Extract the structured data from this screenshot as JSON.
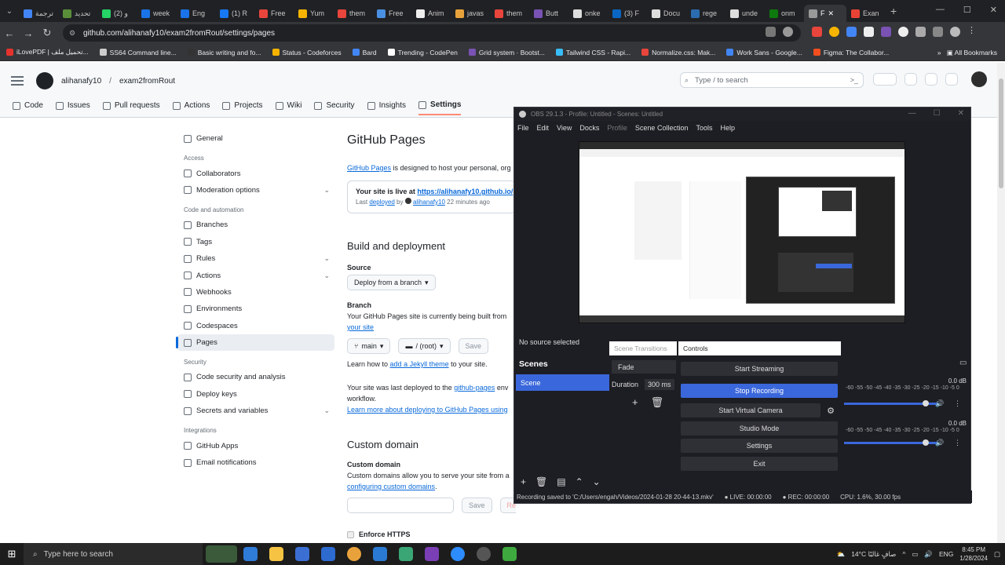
{
  "tabs": [
    {
      "label": "ترجمة",
      "color": "#4285f4"
    },
    {
      "label": "تحديد",
      "color": "#5a8f3a"
    },
    {
      "label": "(2) و",
      "color": "#25d366"
    },
    {
      "label": "week",
      "color": "#1a73e8"
    },
    {
      "label": "Eng",
      "color": "#1a73e8"
    },
    {
      "label": "(1) R",
      "color": "#1877f2"
    },
    {
      "label": "Free",
      "color": "#e8453c"
    },
    {
      "label": "Yum",
      "color": "#f6b400"
    },
    {
      "label": "them",
      "color": "#e8453c"
    },
    {
      "label": "Free",
      "color": "#4a90e2"
    },
    {
      "label": "Anim",
      "color": "#eee"
    },
    {
      "label": "javas",
      "color": "#e9a23b"
    },
    {
      "label": "them",
      "color": "#e8453c"
    },
    {
      "label": "Butt",
      "color": "#7952b3"
    },
    {
      "label": "onke",
      "color": "#ddd"
    },
    {
      "label": "(3) F",
      "color": "#0a66c2"
    },
    {
      "label": "Docu",
      "color": "#ddd"
    },
    {
      "label": "rege",
      "color": "#2b6cb0"
    },
    {
      "label": "unde",
      "color": "#ddd"
    },
    {
      "label": "onm",
      "color": "#0e7a0d"
    },
    {
      "label": "F",
      "color": "#999"
    },
    {
      "label": "Exan",
      "color": "#ea4335"
    }
  ],
  "address": {
    "url": "github.com/alihanafy10/exam2fromRout/settings/pages"
  },
  "bookmarks": [
    {
      "label": "iLovePDF | تحميل ملف...",
      "color": "#e5322d"
    },
    {
      "label": "SS64 Command line...",
      "color": "#ccc"
    },
    {
      "label": "Basic writing and fo...",
      "color": "#333"
    },
    {
      "label": "Status - Codeforces",
      "color": "#f6b400"
    },
    {
      "label": "Bard",
      "color": "#4285f4"
    },
    {
      "label": "Trending - CodePen",
      "color": "#fff"
    },
    {
      "label": "Grid system · Bootst...",
      "color": "#7952b3"
    },
    {
      "label": "Tailwind CSS - Rapi...",
      "color": "#38bdf8"
    },
    {
      "label": "Normalize.css: Mak...",
      "color": "#e8453c"
    },
    {
      "label": "Work Sans - Google...",
      "color": "#4285f4"
    },
    {
      "label": "Figma: The Collabor...",
      "color": "#f24e1e"
    }
  ],
  "bookmarks_all": "All Bookmarks",
  "gh": {
    "owner": "alihanafy10",
    "repo": "exam2fromRout",
    "search_placeholder": "Type / to search",
    "repo_tabs": [
      "Code",
      "Issues",
      "Pull requests",
      "Actions",
      "Projects",
      "Wiki",
      "Security",
      "Insights",
      "Settings"
    ]
  },
  "sidebar": {
    "general": "General",
    "access_h": "Access",
    "access": [
      "Collaborators",
      "Moderation options"
    ],
    "code_h": "Code and automation",
    "code": [
      "Branches",
      "Tags",
      "Rules",
      "Actions",
      "Webhooks",
      "Environments",
      "Codespaces",
      "Pages"
    ],
    "security_h": "Security",
    "security": [
      "Code security and analysis",
      "Deploy keys",
      "Secrets and variables"
    ],
    "integrations_h": "Integrations",
    "integrations": [
      "GitHub Apps",
      "Email notifications"
    ]
  },
  "main": {
    "title": "GitHub Pages",
    "intro_link": "GitHub Pages",
    "intro": " is designed to host your personal, org",
    "live_prefix": "Your site is live at ",
    "live_url": "https://alihanafy10.github.io/",
    "last": "Last ",
    "deployed": "deployed",
    "by": " by ",
    "user": "alihanafy10",
    "ago": " 22 minutes ago",
    "build_title": "Build and deployment",
    "source_label": "Source",
    "source_value": "Deploy from a branch",
    "branch_label": "Branch",
    "branch_desc": "Your GitHub Pages site is currently being built from",
    "your_site": "your site",
    "branch_value": "main",
    "folder_value": "/ (root)",
    "save": "Save",
    "learn_prefix": "Learn how to ",
    "jekyll": "add a Jekyll theme",
    "learn_suffix": " to your site.",
    "deployed_prefix": "Your site was last deployed to the ",
    "gh_pages": "github-pages",
    "deployed_suffix": " env",
    "workflow": "workflow.",
    "learn_more": "Learn more about deploying to GitHub Pages using",
    "custom_title": "Custom domain",
    "custom_label": "Custom domain",
    "custom_desc": "Custom domains allow you to serve your site from a",
    "configuring": "configuring custom domains",
    "save2": "Save",
    "remove": "Remove",
    "https": "Enforce HTTPS"
  },
  "obs": {
    "title": "OBS 29.1.3 - Profile: Untitled - Scenes: Untitled",
    "menu": [
      "File",
      "Edit",
      "View",
      "Docks",
      "Profile",
      "Scene Collection",
      "Tools",
      "Help"
    ],
    "no_source": "No source selected",
    "scene_transitions": "Scene Transitions",
    "controls": "Controls",
    "scenes": "Scenes",
    "scene_item": "Scene",
    "transition": "Fade",
    "duration_label": "Duration",
    "duration_value": "300 ms",
    "buttons": [
      "Start Streaming",
      "Stop Recording",
      "Start Virtual Camera",
      "Studio Mode",
      "Settings",
      "Exit"
    ],
    "db1": "0.0 dB",
    "db2": "0.0 dB",
    "scale": "-60  -55  -50  -45  -40  -35  -30  -25  -20  -15  -10  -5  0",
    "status_saved": "Recording saved to 'C:/Users/engah/Videos/2024-01-28 20-44-13.mkv'",
    "live": "LIVE: 00:00:00",
    "rec": "REC: 00:00:00",
    "cpu": "CPU: 1.6%, 30.00 fps"
  },
  "taskbar": {
    "search": "Type here to search",
    "weather": "14°C  صافٍ غالبًا",
    "lang": "ENG",
    "time": "8:45 PM",
    "date": "1/28/2024"
  }
}
